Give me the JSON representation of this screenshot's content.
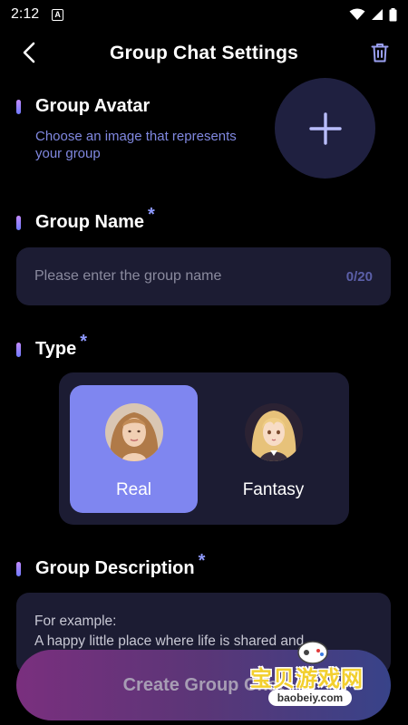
{
  "status_bar": {
    "time": "2:12",
    "notification_icon": "A"
  },
  "header": {
    "title": "Group Chat Settings"
  },
  "avatar_section": {
    "label": "Group Avatar",
    "description": "Choose an image that represents your group"
  },
  "name_section": {
    "label": "Group Name",
    "required_mark": "*",
    "placeholder": "Please enter the group name",
    "counter": "0/20"
  },
  "type_section": {
    "label": "Type",
    "required_mark": "*",
    "options": [
      {
        "label": "Real",
        "selected": true
      },
      {
        "label": "Fantasy",
        "selected": false
      }
    ]
  },
  "description_section": {
    "label": "Group Description",
    "required_mark": "*",
    "placeholder": "For example:\nA happy little place where life is shared and"
  },
  "create_button": {
    "label": "Create Group Chat"
  },
  "watermark": {
    "text": "宝贝游戏网",
    "url": "baobeiy.com"
  },
  "colors": {
    "background": "#000000",
    "card": "#1c1c33",
    "accent": "#7f86f0",
    "hint": "#8088e0"
  }
}
